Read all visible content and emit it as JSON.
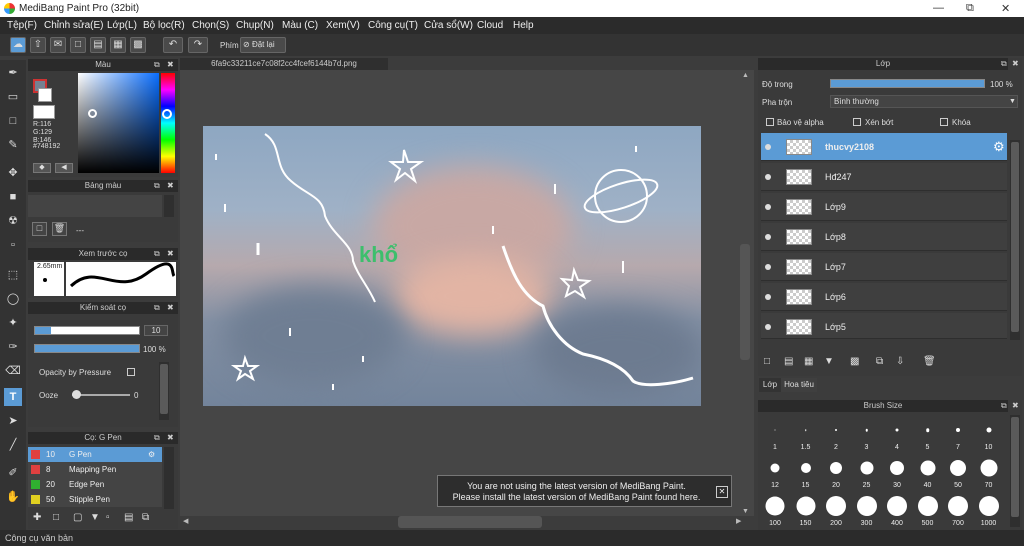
{
  "window": {
    "title": "MediBang Paint Pro (32bit)"
  },
  "menu": [
    "Tệp(F)",
    "Chỉnh sửa(E)",
    "Lớp(L)",
    "Bộ lọc(R)",
    "Chọn(S)",
    "Chụp(N)",
    "Màu (C)",
    "Xem(V)",
    "Công cụ(T)",
    "Cửa sổ(W)",
    "Cloud",
    "Help"
  ],
  "toolbar": {
    "phim_label": "Phím",
    "reset_label": "Đặt lại"
  },
  "color_panel": {
    "title": "Màu",
    "r": "R:116",
    "g": "G:129",
    "b": "B:146",
    "hex": "#748192",
    "primary": "#748192",
    "secondary": "#ffffff"
  },
  "palette_panel": {
    "title": "Bảng màu",
    "empty": "---"
  },
  "preview_panel": {
    "title": "Xem trước cọ",
    "size": "2.65mm"
  },
  "brush_control": {
    "title": "Kiểm soát cọ",
    "size_value": "10",
    "opacity_value": "100 %",
    "opacity_pressure": "Opacity by Pressure",
    "ooze_label": "Ooze",
    "ooze_value": "0",
    "size_fill": 0.15,
    "opacity_fill": 1.0
  },
  "brush_list": {
    "title": "Cọ: G Pen",
    "items": [
      {
        "size": "10",
        "name": "G Pen",
        "color": "#e04040",
        "selected": true
      },
      {
        "size": "8",
        "name": "Mapping Pen",
        "color": "#e04040",
        "selected": false
      },
      {
        "size": "20",
        "name": "Edge Pen",
        "color": "#30b030",
        "selected": false
      },
      {
        "size": "50",
        "name": "Stipple Pen",
        "color": "#e0d020",
        "selected": false
      }
    ]
  },
  "document": {
    "tab": "6fa9c33211ce7c08f2cc4fcef6144b7d.png",
    "canvas_text": "khổ"
  },
  "notice": {
    "line1": "You are not using the latest version of MediBang Paint.",
    "line2": "Please install the latest version of MediBang Paint found here."
  },
  "layer_panel": {
    "title": "Lớp",
    "opacity_label": "Độ trong",
    "opacity_value": "100 %",
    "blend_label": "Pha trộn",
    "blend_value": "Bình thường",
    "protect_alpha": "Bảo vệ alpha",
    "clipping": "Xén bớt",
    "lock": "Khóa",
    "layers": [
      {
        "name": "thucvy2108",
        "selected": true
      },
      {
        "name": "Hđ247",
        "selected": false
      },
      {
        "name": "Lớp9",
        "selected": false
      },
      {
        "name": "Lớp8",
        "selected": false
      },
      {
        "name": "Lớp7",
        "selected": false
      },
      {
        "name": "Lớp6",
        "selected": false
      },
      {
        "name": "Lớp5",
        "selected": false
      }
    ],
    "tab_layer": "Lớp",
    "tab_navigator": "Hoa tiêu",
    "opacity_fill": 1.0
  },
  "brush_size_panel": {
    "title": "Brush Size",
    "sizes": [
      "1",
      "1.5",
      "2",
      "3",
      "4",
      "5",
      "7",
      "10",
      "12",
      "15",
      "20",
      "25",
      "30",
      "40",
      "50",
      "70",
      "100",
      "150",
      "200",
      "300",
      "400",
      "500",
      "700",
      "1000"
    ]
  },
  "status_bar": {
    "text": "Công cụ văn bản"
  }
}
